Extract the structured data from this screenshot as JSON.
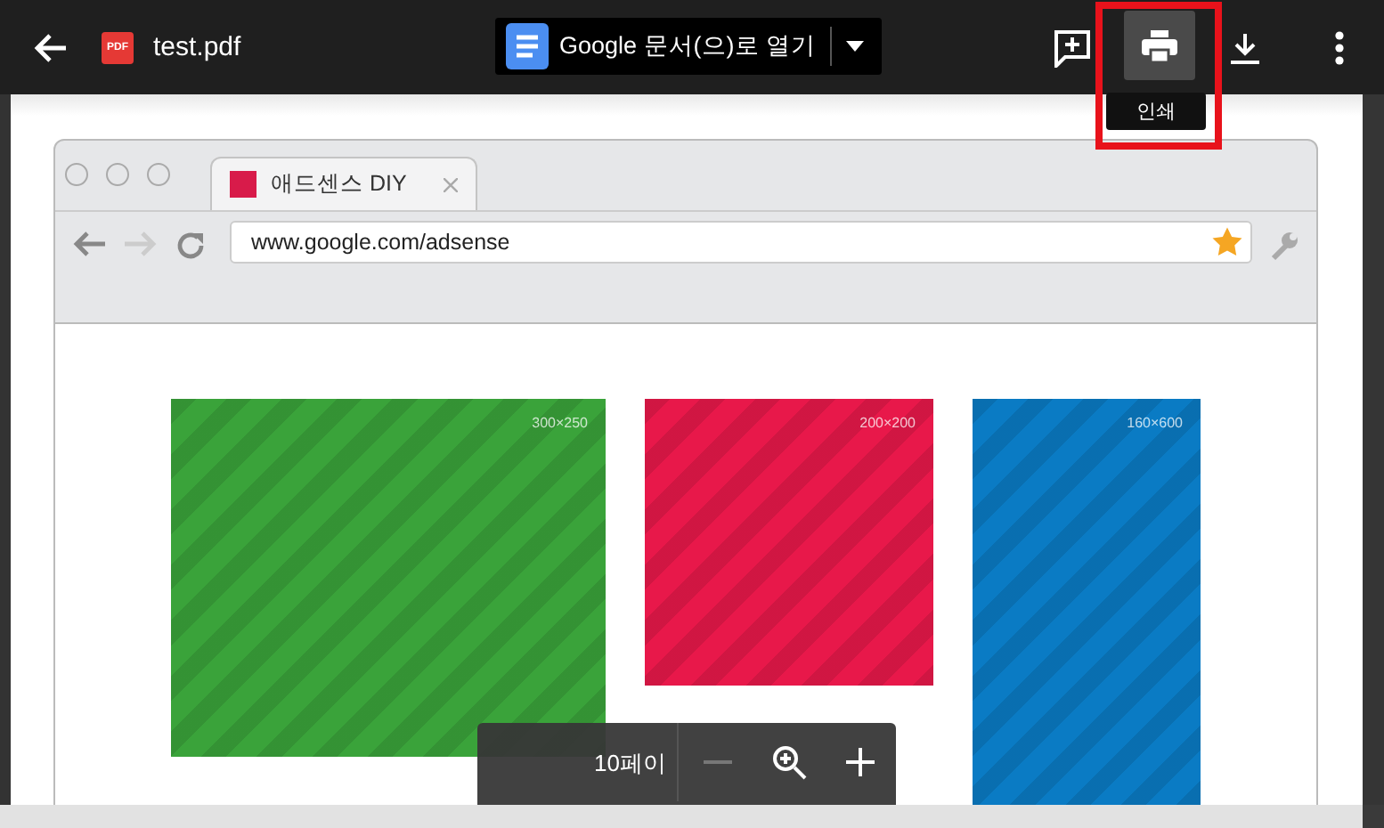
{
  "viewer": {
    "file_name": "test.pdf",
    "file_badge": "PDF",
    "open_with": "Google 문서(으)로 열기",
    "print_tooltip": "인쇄",
    "print_highlighted": true
  },
  "document": {
    "tab_title": "애드센스 DIY",
    "url": "www.google.com/adsense",
    "ads": [
      {
        "size": "300×250",
        "color": "#3aa33a"
      },
      {
        "size": "200×200",
        "color": "#e8184a"
      },
      {
        "size": "160×600",
        "color": "#0a7bc4"
      }
    ]
  },
  "page_controls": {
    "page_label": "10페이"
  }
}
